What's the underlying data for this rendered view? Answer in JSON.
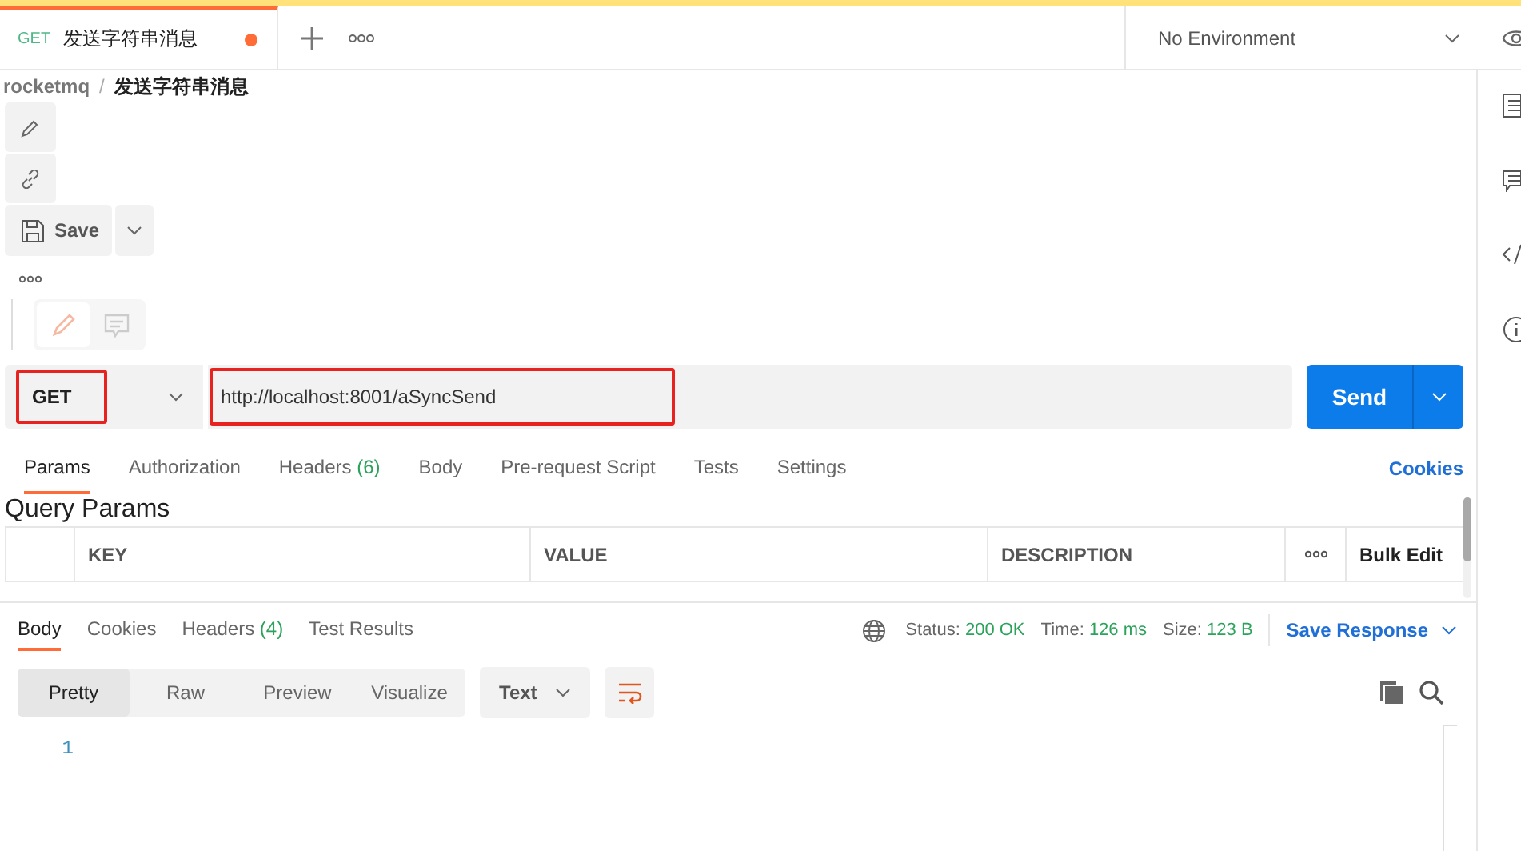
{
  "tabs": [
    {
      "method": "GET",
      "title": "发送字符串消息",
      "unsaved": true,
      "selected": true
    }
  ],
  "environment": {
    "value": "No Environment"
  },
  "breadcrumb": {
    "collection": "rocketmq",
    "separator": "/",
    "request": "发送字符串消息"
  },
  "save_button": "Save",
  "mode_toggle": [
    {
      "kind": "edit",
      "selected": true
    },
    {
      "kind": "comment",
      "selected": false
    }
  ],
  "request": {
    "method": "GET",
    "method_highlighted": true,
    "url": "http://localhost:8001/aSyncSend",
    "url_highlighted": true,
    "send": "Send"
  },
  "request_tabs": [
    {
      "label": "Params",
      "selected": true
    },
    {
      "label": "Authorization",
      "selected": false
    },
    {
      "label": "Headers",
      "count": "(6)",
      "selected": false
    },
    {
      "label": "Body",
      "selected": false
    },
    {
      "label": "Pre-request Script",
      "selected": false
    },
    {
      "label": "Tests",
      "selected": false
    },
    {
      "label": "Settings",
      "selected": false
    }
  ],
  "cookies_link": "Cookies",
  "query_params": {
    "title": "Query Params",
    "columns": [
      "KEY",
      "VALUE",
      "DESCRIPTION"
    ],
    "bulk_edit": "Bulk Edit"
  },
  "response_tabs": [
    {
      "label": "Body",
      "selected": true
    },
    {
      "label": "Cookies",
      "selected": false
    },
    {
      "label": "Headers",
      "count": "(4)",
      "selected": false
    },
    {
      "label": "Test Results",
      "selected": false
    }
  ],
  "response_stats": [
    {
      "label": "Status:",
      "value": "200 OK"
    },
    {
      "label": "Time:",
      "value": "126 ms"
    },
    {
      "label": "Size:",
      "value": "123 B"
    }
  ],
  "save_response": "Save Response",
  "view_modes": [
    {
      "label": "Pretty",
      "selected": true
    },
    {
      "label": "Raw",
      "selected": false
    },
    {
      "label": "Preview",
      "selected": false
    },
    {
      "label": "Visualize",
      "selected": false
    }
  ],
  "format": "Text",
  "line_numbers": [
    "1"
  ]
}
